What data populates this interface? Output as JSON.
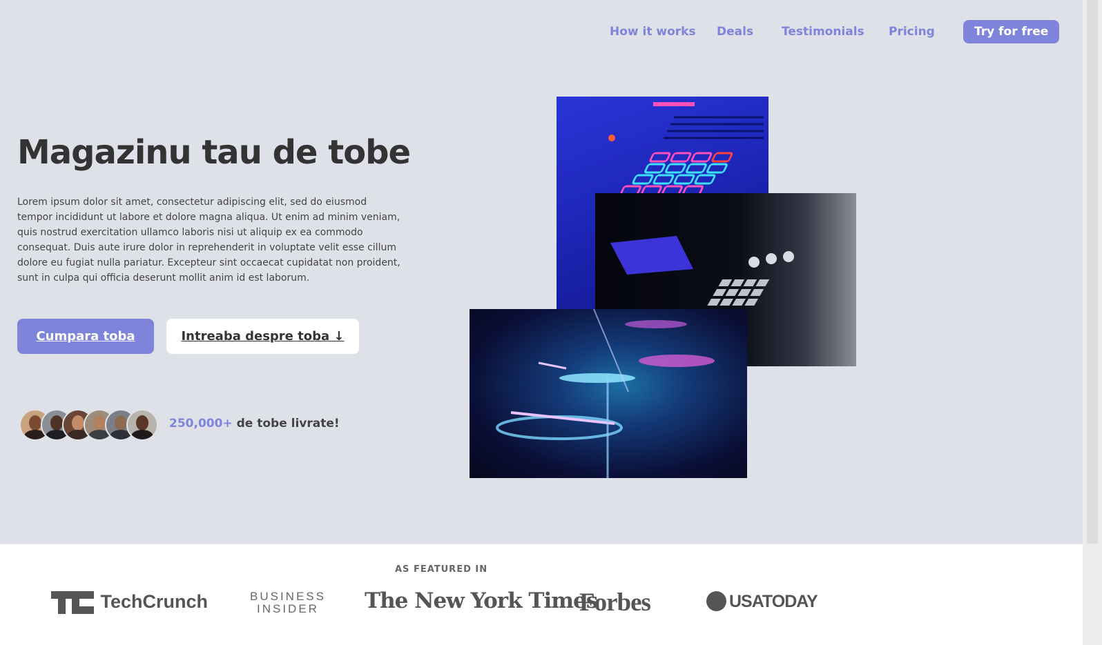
{
  "nav": {
    "items": [
      "How it works",
      "Deals",
      "Testimonials",
      "Pricing"
    ],
    "cta": "Try for free"
  },
  "hero": {
    "title": "Magazinu tau de tobe",
    "description": "Lorem ipsum dolor sit amet, consectetur adipiscing elit, sed do eiusmod tempor incididunt ut labore et dolore magna aliqua. Ut enim ad minim veniam, quis nostrud exercitation ullamco laboris nisi ut aliquip ex ea commodo consequat. Duis aute irure dolor in reprehenderit in voluptate velit esse cillum dolore eu fugiat nulla pariatur. Excepteur sint occaecat cupidatat non proident, sunt in culpa qui officia deserunt mollit anim id est laborum.",
    "primary_button": "Cumpara toba",
    "secondary_button": "Intreaba despre toba ↓",
    "stat_number": "250,000+",
    "stat_text": " de tobe livrate!"
  },
  "featured": {
    "label": "AS FEATURED IN",
    "logos": [
      "TechCrunch",
      "BUSINESS",
      "INSIDER",
      "The New York Times",
      "Forbes",
      "USATODAY"
    ]
  },
  "colors": {
    "accent": "#7f84db",
    "hero_bg": "#dee1e7",
    "text": "#333333"
  }
}
